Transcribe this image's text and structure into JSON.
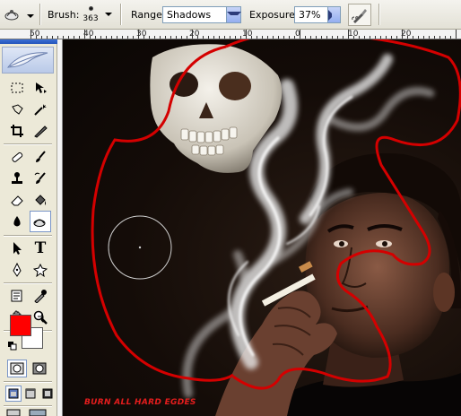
{
  "options_bar": {
    "brush_label": "Brush:",
    "brush_size": "363",
    "range_label": "Range:",
    "range_value": "Shadows",
    "exposure_label": "Exposure:",
    "exposure_value": "37%"
  },
  "rulers": {
    "top_labels": [
      "50",
      "40",
      "30",
      "20",
      "10",
      "0",
      "10",
      "20"
    ]
  },
  "tools": {
    "active": "burn-tool",
    "foreground_color": "#ff0000",
    "background_color": "#ffffff"
  },
  "canvas": {
    "caption": "BURN ALL HARD EGDES",
    "path_color": "#d40000"
  }
}
